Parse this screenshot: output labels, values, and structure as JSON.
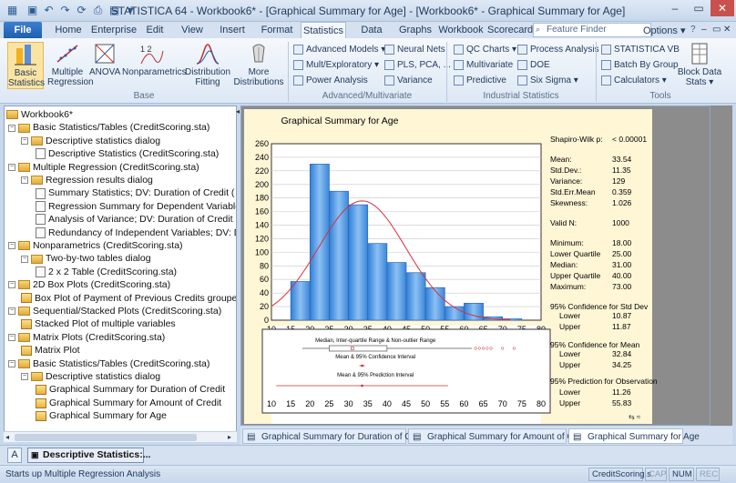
{
  "window": {
    "title": "STATISTICA 64 - Workbook6* - [Graphical Summary for Age] - [Workbook6* - Graphical Summary for Age]"
  },
  "quick_access": [
    "save-icon",
    "undo-icon",
    "redo-icon",
    "refresh-icon",
    "print-icon",
    "table-icon"
  ],
  "tabs": {
    "file": "File",
    "items": [
      "Home",
      "Enterprise",
      "Edit",
      "View",
      "Insert",
      "Format",
      "Statistics",
      "Data Minin",
      "Graphs",
      "Workbook",
      "Scorecard"
    ],
    "active": "Statistics"
  },
  "search": {
    "placeholder": "Feature Finder"
  },
  "options": {
    "label": "Options"
  },
  "ribbon": {
    "base": {
      "label": "Base",
      "buttons": [
        "Basic Statistics",
        "Multiple Regression",
        "ANOVA",
        "Nonparametrics",
        "Distribution Fitting",
        "More Distributions"
      ]
    },
    "advanced": {
      "label": "Advanced/Multivariate",
      "items": [
        "Advanced Models",
        "Mult/Exploratory",
        "Power Analysis",
        "Neural Nets",
        "PLS, PCA, ...",
        "Variance"
      ]
    },
    "industrial": {
      "label": "Industrial Statistics",
      "items": [
        "QC Charts",
        "Multivariate",
        "Predictive",
        "Process Analysis",
        "DOE",
        "Six Sigma"
      ]
    },
    "tools": {
      "label": "Tools",
      "items": [
        "STATISTICA VB",
        "Batch By Group",
        "Calculators",
        "Block Data Stats"
      ]
    }
  },
  "tree": {
    "root": "Workbook6*",
    "items": [
      {
        "level": 1,
        "type": "folder",
        "label": "Basic Statistics/Tables (CreditScoring.sta)"
      },
      {
        "level": 2,
        "type": "folder",
        "label": "Descriptive statistics dialog"
      },
      {
        "level": 3,
        "type": "doc",
        "label": "Descriptive Statistics (CreditScoring.sta)"
      },
      {
        "level": 1,
        "type": "folder",
        "label": "Multiple Regression (CreditScoring.sta)"
      },
      {
        "level": 2,
        "type": "folder",
        "label": "Regression results dialog"
      },
      {
        "level": 3,
        "type": "doc",
        "label": "Summary Statistics; DV: Duration of Credit ("
      },
      {
        "level": 3,
        "type": "doc",
        "label": "Regression Summary for Dependent Variable"
      },
      {
        "level": 3,
        "type": "doc",
        "label": "Analysis of Variance; DV: Duration of Credit ("
      },
      {
        "level": 3,
        "type": "doc",
        "label": "Redundancy of Independent Variables; DV: D"
      },
      {
        "level": 1,
        "type": "folder",
        "label": "Nonparametrics (CreditScoring.sta)"
      },
      {
        "level": 2,
        "type": "folder",
        "label": "Two-by-two tables dialog"
      },
      {
        "level": 3,
        "type": "doc",
        "label": "2 x 2 Table (CreditScoring.sta)"
      },
      {
        "level": 1,
        "type": "folder",
        "label": "2D Box Plots (CreditScoring.sta)"
      },
      {
        "level": 2,
        "type": "graph",
        "label": "Box Plot of Payment of Previous Credits groupe"
      },
      {
        "level": 1,
        "type": "folder",
        "label": "Sequential/Stacked Plots (CreditScoring.sta)"
      },
      {
        "level": 2,
        "type": "graph",
        "label": "Stacked Plot of multiple variables"
      },
      {
        "level": 1,
        "type": "folder",
        "label": "Matrix Plots (CreditScoring.sta)"
      },
      {
        "level": 2,
        "type": "graph",
        "label": "Matrix Plot"
      },
      {
        "level": 1,
        "type": "folder",
        "label": "Basic Statistics/Tables (CreditScoring.sta)"
      },
      {
        "level": 2,
        "type": "folder",
        "label": "Descriptive statistics dialog"
      },
      {
        "level": 3,
        "type": "graph",
        "label": "Graphical Summary for Duration of Credit"
      },
      {
        "level": 3,
        "type": "graph",
        "label": "Graphical Summary for Amount of Credit"
      },
      {
        "level": 3,
        "type": "graph",
        "label": "Graphical Summary for Age"
      }
    ]
  },
  "summary": {
    "rows": [
      {
        "label": "Shapiro-Wilk p:",
        "value": "< 0.00001"
      },
      {
        "label": "Mean:",
        "value": "33.54"
      },
      {
        "label": "Std.Dev.:",
        "value": "11.35"
      },
      {
        "label": "Variance:",
        "value": "129"
      },
      {
        "label": "Std.Err.Mean",
        "value": "0.359"
      },
      {
        "label": "Skewness:",
        "value": "1.026"
      },
      {
        "label": "Valid N:",
        "value": "1000"
      },
      {
        "label": "Minimum:",
        "value": "18.00"
      },
      {
        "label": "Lower Quartile",
        "value": "25.00"
      },
      {
        "label": "Median:",
        "value": "31.00"
      },
      {
        "label": "Upper Quartile",
        "value": "40.00"
      },
      {
        "label": "Maximum:",
        "value": "73.00"
      },
      {
        "label": "95% Confidence for Std Dev",
        "value": ""
      },
      {
        "label": "Lower",
        "value": "10.87"
      },
      {
        "label": "Upper",
        "value": "11.87"
      },
      {
        "label": "95% Confidence for Mean",
        "value": ""
      },
      {
        "label": "Lower",
        "value": "32.84"
      },
      {
        "label": "Upper",
        "value": "34.25"
      },
      {
        "label": "95% Prediction for Observation",
        "value": ""
      },
      {
        "label": "Lower",
        "value": "11.26"
      },
      {
        "label": "Upper",
        "value": "55.83"
      }
    ]
  },
  "chart_data": [
    {
      "type": "bar",
      "title": "Graphical Summary for Age",
      "x_edges": [
        15,
        20,
        25,
        30,
        35,
        40,
        45,
        50,
        55,
        60,
        65,
        70,
        75
      ],
      "values": [
        57,
        230,
        190,
        170,
        113,
        85,
        70,
        48,
        20,
        25,
        5,
        2,
        5
      ],
      "normal_fit": {
        "mean": 33.54,
        "sd": 11.35,
        "n": 1000,
        "bin_width": 5
      },
      "xticks": [
        10,
        15,
        20,
        25,
        30,
        35,
        40,
        45,
        50,
        55,
        60,
        65,
        70,
        75,
        80
      ],
      "yticks": [
        0,
        20,
        40,
        60,
        80,
        100,
        120,
        140,
        160,
        180,
        200,
        220,
        240,
        260
      ],
      "xlim": [
        10,
        80
      ],
      "ylim": [
        0,
        260
      ],
      "colors": {
        "bar": "#4f9ae6",
        "curve": "#d9303a"
      }
    },
    {
      "type": "box",
      "xlim": [
        10,
        80
      ],
      "xticks": [
        10,
        15,
        20,
        25,
        30,
        35,
        40,
        45,
        50,
        55,
        60,
        65,
        70,
        75,
        80
      ],
      "rows": [
        {
          "label": "Median, Inter-quartile Range & Non-outlier Range",
          "min": 18,
          "q1": 25,
          "median": 31,
          "q3": 40,
          "max": 62,
          "outliers": [
            63,
            64,
            65,
            66,
            67,
            70,
            73
          ]
        },
        {
          "label": "Mean & 95% Confidence Interval",
          "center": 33.54,
          "lo": 32.84,
          "hi": 34.25
        },
        {
          "label": "Mean & 95% Prediction Interval",
          "center": 33.54,
          "lo": 11.26,
          "hi": 55.83
        }
      ]
    }
  ],
  "doc_tabs": [
    "Graphical Summary for Duration of Credit",
    "Graphical Summary for Amount of Credit",
    "Graphical Summary for Age"
  ],
  "taskbar": {
    "item": "Descriptive Statistics:..."
  },
  "status": {
    "text": "Starts up Multiple Regression Analysis",
    "panels": [
      "CreditScoring.s",
      "CAP",
      "NUM",
      "REC"
    ]
  }
}
